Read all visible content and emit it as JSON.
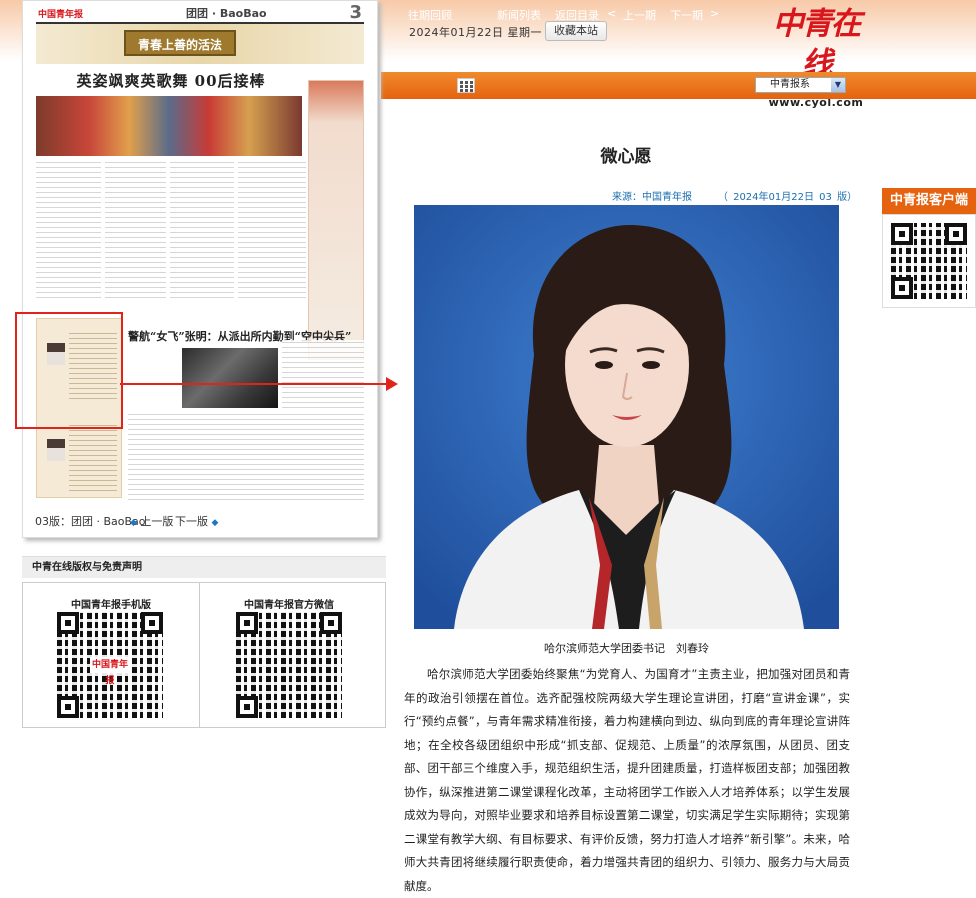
{
  "header": {
    "date": "2024年01月22日  星期一",
    "favorite_label": "收藏本站",
    "logo_text": "中青在线",
    "logo_url": "www.cyol.com"
  },
  "nav": {
    "items": [
      "往期回顾",
      "新闻列表",
      "返回目录",
      "上一期",
      "下一期"
    ],
    "prev_arrow": "<",
    "next_arrow": ">",
    "select_value": "中青报系"
  },
  "paper": {
    "name": "中国青年报",
    "section": "团团 · BaoBao",
    "page_number": "3",
    "banner_title": "青春上善的活法",
    "headline": "英姿飒爽英歌舞 00后接棒",
    "sub_headline": "警航“女飞”张明：从派出所内勤到“空中尖兵”"
  },
  "pager": {
    "label": "03版：团团 · BaoBao",
    "prev": "上一版",
    "next": "下一版"
  },
  "copyright": {
    "title": "中青在线版权与免责声明",
    "qr_mobile_label": "中国青年报手机版",
    "qr_wechat_label": "中国青年报官方微信",
    "qr_logo": "中国青年报"
  },
  "article": {
    "title": "微心愿",
    "source": "来源：中国青年报",
    "date_info": "（ 2024年01月22日    03 版）",
    "caption": "哈尔滨师范大学团委书记　刘春玲",
    "body": "哈尔滨师范大学团委始终聚焦“为党育人、为国育才”主责主业，把加强对团员和青年的政治引领摆在首位。选齐配强校院两级大学生理论宣讲团，打磨“宣讲金课”，实行“预约点餐”，与青年需求精准衔接，着力构建横向到边、纵向到底的青年理论宣讲阵地；在全校各级团组织中形成“抓支部、促规范、上质量”的浓厚氛围，从团员、团支部、团干部三个维度入手，规范组织生活，提升团建质量，打造样板团支部；加强团教协作，纵深推进第二课堂课程化改革，主动将团学工作嵌入人才培养体系；以学生发展成效为导向，对照毕业要求和培养目标设置第二课堂，切实满足学生实际期待；实现第二课堂有教学大纲、有目标要求、有评价反馈，努力打造人才培养“新引擎”。未来，哈师大共青团将继续履行职责使命，着力增强共青团的组织力、引领力、服务力与大局贡献度。"
  },
  "float": {
    "label": "中青报客户端"
  },
  "colors": {
    "accent_orange": "#e5620e",
    "brand_red": "#d8161b",
    "link_blue": "#1b6fb3",
    "highlight_red": "#e0241c"
  }
}
